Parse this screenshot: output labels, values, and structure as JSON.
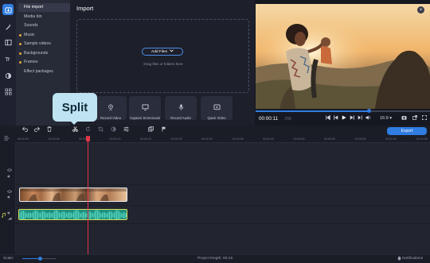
{
  "sidebar": {
    "categories": [
      {
        "label": "File import",
        "active": true,
        "dot": false
      },
      {
        "label": "Media bin",
        "active": false,
        "dot": false
      },
      {
        "label": "Sounds",
        "active": false,
        "dot": false
      },
      {
        "label": "Music",
        "active": false,
        "dot": true
      },
      {
        "label": "Sample videos",
        "active": false,
        "dot": true
      },
      {
        "label": "Backgrounds",
        "active": false,
        "dot": true
      },
      {
        "label": "Frames",
        "active": false,
        "dot": true
      },
      {
        "label": "Effect packages",
        "active": false,
        "dot": false
      }
    ],
    "rail_icons": [
      "import-icon",
      "magic-wand-icon",
      "panels-icon",
      "text-icon",
      "filter-icon",
      "apps-grid-icon"
    ]
  },
  "import_panel": {
    "title": "Import",
    "add_files_label": "Add Files",
    "drag_hint": "Drag files or folders here",
    "tiles": [
      {
        "label": "Record Video",
        "icon": "webcam-icon"
      },
      {
        "label": "Capture Screencast",
        "icon": "screen-capture-icon"
      },
      {
        "label": "Record Audio",
        "icon": "microphone-icon"
      },
      {
        "label": "Quick Video",
        "icon": "quick-video-icon"
      }
    ]
  },
  "tooltip": {
    "text": "Split"
  },
  "player": {
    "current_time": "00:00:11",
    "current_ms": ".700",
    "progress": 0.65,
    "aspect_ratio": "16:9",
    "close_label": "×"
  },
  "toolbar": {
    "export_label": "Export"
  },
  "timeline": {
    "ticks": [
      "00:00:00",
      "00:00:05",
      "00:00:10",
      "00:00:15",
      "00:00:20",
      "00:00:25",
      "00:00:30",
      "00:00:35",
      "00:00:40",
      "00:00:45",
      "00:00:50",
      "00:00:55",
      "00:01:00",
      "00:01:05"
    ]
  },
  "status": {
    "scale_label": "Scale:",
    "project_length": "Project length:  00:18",
    "notifications_label": "Notifications"
  },
  "colors": {
    "accent": "#2f7de1",
    "playhead": "#e2344a",
    "tooltip_bg": "#bfe3f1",
    "audio_clip": "#1f8f7e",
    "audio_border": "#d9e05a"
  }
}
